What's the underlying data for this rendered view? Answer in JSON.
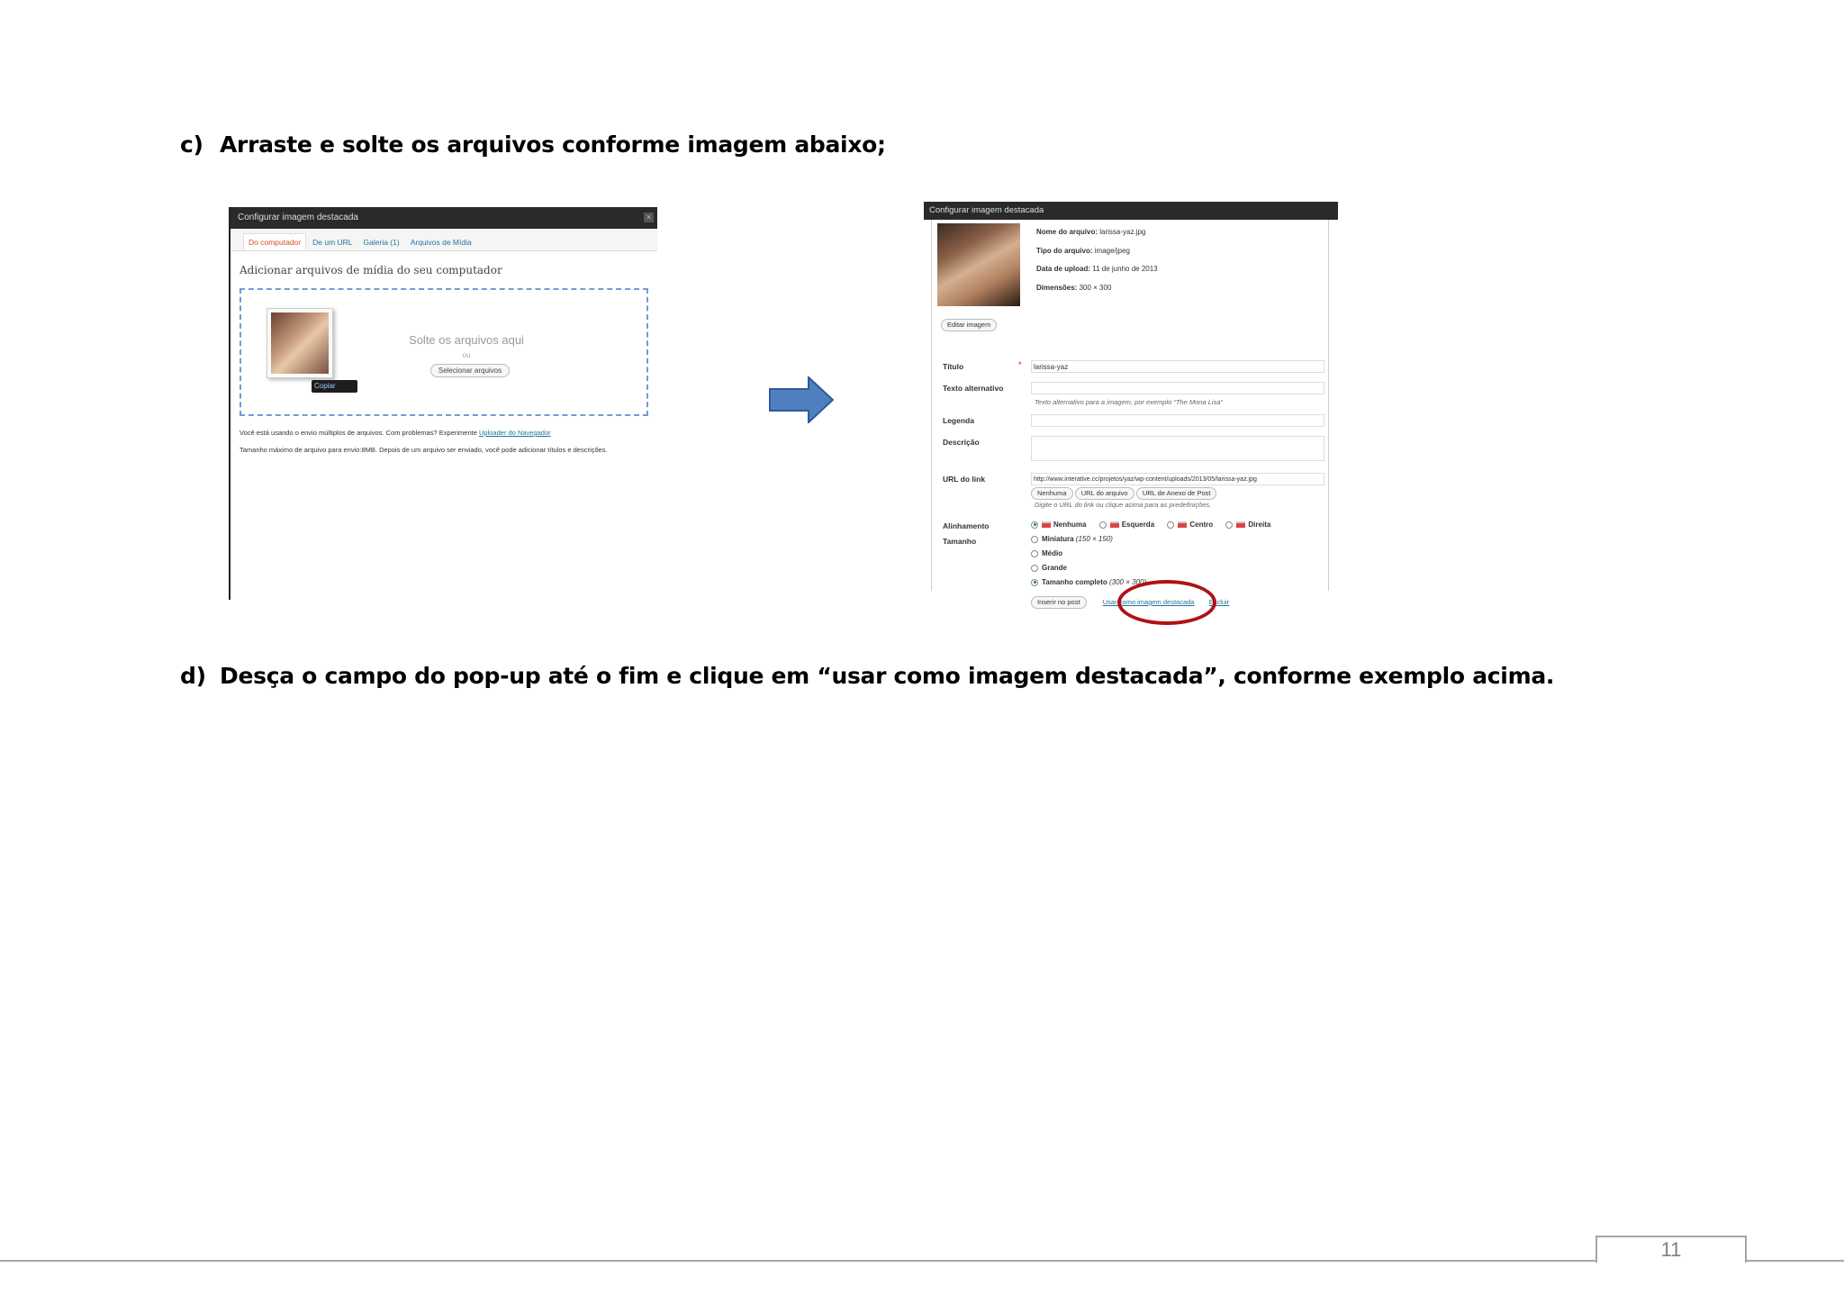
{
  "steps": {
    "c": {
      "label": "c)",
      "text": "Arraste e solte os arquivos conforme imagem abaixo;"
    },
    "d": {
      "label": "d)",
      "text": "Desça o campo do pop-up até o fim e clique em  “usar como imagem destacada”, conforme exemplo acima."
    }
  },
  "left_screenshot": {
    "title": "Configurar imagem destacada",
    "close": "×",
    "tabs": [
      "Do computador",
      "De um URL",
      "Galeria (1)",
      "Arquivos de Mídia"
    ],
    "heading": "Adicionar arquivos de mídia do seu computador",
    "drop_text": "Solte os arquivos aqui",
    "or_text": "ou",
    "select_button": "Selecionar arquivos",
    "copy_badge": "Copiar",
    "note1_prefix": "Você está usando o envio múltiplos de arquivos. Com problemas? Experimente",
    "note1_link": "Uploader do Navegador",
    "note2": "Tamanho máximo de arquivo para envio:8MB. Depois de um arquivo ser enviado, você pode adicionar títulos e descrições."
  },
  "right_screenshot": {
    "title": "Configurar imagem destacada",
    "meta": [
      {
        "label": "Nome do arquivo:",
        "value": "larissa-yaz.jpg"
      },
      {
        "label": "Tipo do arquivo:",
        "value": "image/jpeg"
      },
      {
        "label": "Data de upload:",
        "value": "11 de junho de 2013"
      },
      {
        "label": "Dimensões:",
        "value": "300 × 300"
      }
    ],
    "edit_button": "Editar imagem",
    "fields": {
      "title_label": "Título",
      "title_value": "larissa-yaz",
      "required_mark": "*",
      "alt_label": "Texto alternativo",
      "alt_hint": "Texto alternativo para a imagem, por exemplo “The Mona Lisa”",
      "caption_label": "Legenda",
      "description_label": "Descrição",
      "url_label": "URL do link",
      "url_value": "http://www.interative.cc/projetos/yaz/wp-content/uploads/2013/05/larissa-yaz.jpg",
      "url_buttons": [
        "Nenhuma",
        "URL do arquivo",
        "URL de Anexo de Post"
      ],
      "url_hint": "Digite o URL do link ou clique acima para as predefinições."
    },
    "alignment": {
      "label": "Alinhamento",
      "options": [
        "Nenhuma",
        "Esquerda",
        "Centro",
        "Direita"
      ],
      "selected": "Nenhuma"
    },
    "size": {
      "label": "Tamanho",
      "options": [
        {
          "name": "Miniatura",
          "note": "(150 × 150)"
        },
        {
          "name": "Médio",
          "note": ""
        },
        {
          "name": "Grande",
          "note": ""
        },
        {
          "name": "Tamanho completo",
          "note": "(300 × 300)"
        }
      ],
      "selected": "Tamanho completo"
    },
    "actions": {
      "insert": "Inserir no post",
      "featured": "Usar como imagem destacada",
      "delete": "Excluir"
    },
    "highlight_color": "#b01116"
  },
  "arrow_color": "#4f7fbf",
  "page_number": "11"
}
